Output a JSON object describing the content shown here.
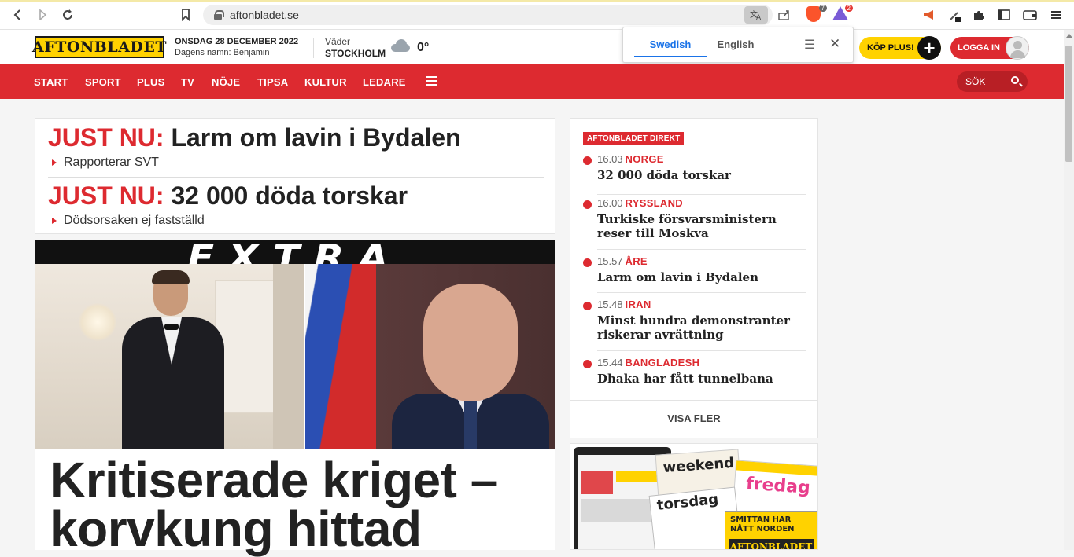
{
  "browser": {
    "url": "aftonbladet.se",
    "brave_count": "7",
    "rewards_count": "2"
  },
  "header": {
    "logo": "AFTONBLADET",
    "date": "ONSDAG 28 DECEMBER 2022",
    "name_day": "Dagens namn: Benjamin",
    "weather_label": "Väder",
    "weather_city": "STOCKHOLM",
    "weather_temp": "0°",
    "kop_plus": "KÖP PLUS!",
    "logga_in": "LOGGA IN"
  },
  "translate": {
    "source_lang": "Swedish",
    "target_lang": "English"
  },
  "nav": {
    "items": [
      "START",
      "SPORT",
      "PLUS",
      "TV",
      "NÖJE",
      "TIPSA",
      "KULTUR",
      "LEDARE"
    ],
    "search": "SÖK"
  },
  "justnu": [
    {
      "prefix": "JUST NU:",
      "title": "Larm om lavin i Bydalen",
      "sub": "Rapporterar SVT"
    },
    {
      "prefix": "JUST NU:",
      "title": "32 000 döda torskar",
      "sub": "Dödsorsaken ej fastställd"
    }
  ],
  "main_story": {
    "banner": "EXTRA",
    "headline_line1": "Kritiserade kriget –",
    "headline_line2": "korvkung hittad"
  },
  "direkt": {
    "label": "AFTONBLADET DIREKT",
    "items": [
      {
        "time": "16.03",
        "tag": "NORGE",
        "title": "32 000 döda torskar"
      },
      {
        "time": "16.00",
        "tag": "RYSSLAND",
        "title": "Turkiske försvarsministern reser till Moskva"
      },
      {
        "time": "15.57",
        "tag": "ÅRE",
        "title": "Larm om lavin i Bydalen"
      },
      {
        "time": "15.48",
        "tag": "IRAN",
        "title": "Minst hundra demonstranter riskerar avrättning"
      },
      {
        "time": "15.44",
        "tag": "BANGLADESH",
        "title": "Dhaka har fått tunnelbana"
      }
    ],
    "more": "VISA FLER"
  },
  "promo": {
    "mag_weekend": "weekend",
    "mag_fredag": "fredag",
    "mag_torsdag": "torsdag",
    "mag_smittan": "SMITTAN HAR NÅTT NORDEN",
    "mag_logo": "AFTONBLADET"
  },
  "colors": {
    "brand_red": "#dd2a30",
    "brand_yellow": "#ffd200"
  }
}
